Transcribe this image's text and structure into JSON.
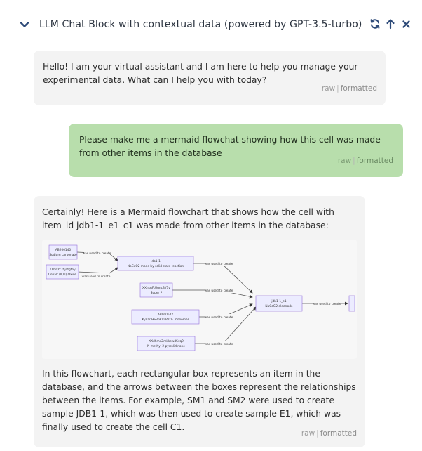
{
  "header": {
    "title": "LLM Chat Block with contextual data (powered by GPT-3.5-turbo)",
    "icons": [
      "chevron-down-icon",
      "refresh-icon",
      "arrow-up-icon",
      "close-icon"
    ]
  },
  "messages": [
    {
      "role": "assistant",
      "text": "Hello! I am your virtual assistant and I am here to help you manage your experimental data. What can I help you with today?",
      "raw_label": "raw",
      "formatted_label": "formatted"
    },
    {
      "role": "user",
      "text": "Please make me a mermaid flowchat showing how this cell was made from other items in the database",
      "raw_label": "raw",
      "formatted_label": "formatted"
    },
    {
      "role": "assistant",
      "text": "Certainly! Here is a Mermaid flowchart that shows how the cell with item_id jdb1-1_e1_c1 was made from other items in the database:",
      "text2": "In this flowchart, each rectangular box represents an item in the database, and the arrows between the boxes represent the relationships between the items. For example, SM1 and SM2 were used to create sample JDB1-1, which was then used to create sample E1, which was finally used to create the cell C1.",
      "raw_label": "raw",
      "formatted_label": "formatted"
    }
  ],
  "flowchart": {
    "nodes": [
      {
        "id": "n1",
        "line1": "AB200140",
        "line2": "Sodium carbonate"
      },
      {
        "id": "n2",
        "line1": "XXhsjYt7tjjr4gtoy",
        "line2": "Cobalt (II,III) Oxide"
      },
      {
        "id": "n3",
        "line1": "jdb1-1",
        "line2": "NaCoO2 made by solid state reaction"
      },
      {
        "id": "n4",
        "line1": "XXhsAFtUgncBIf1y",
        "line2": "Super P"
      },
      {
        "id": "n5",
        "line1": "AB000542",
        "line2": "Kynar HSV 900 PVDF monomer"
      },
      {
        "id": "n6",
        "line1": "XXdhmeZmkkewdSvq9",
        "line2": "N-methyl-2-pyrrolidinone"
      },
      {
        "id": "n7",
        "line1": "jdb1-1_e1",
        "line2": "NaCoO2 electrode"
      },
      {
        "id": "n8",
        "line1": "jdb1-1_e1_c1",
        "line2": "NaCoO2 coin cell"
      }
    ],
    "edge_label": "was used to create"
  }
}
